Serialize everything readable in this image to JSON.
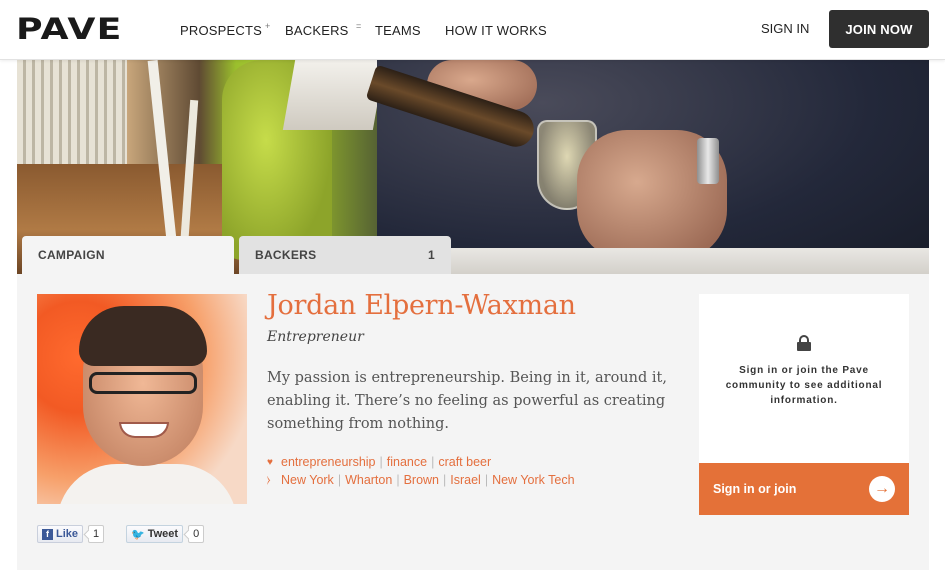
{
  "header": {
    "logo": "PAVE",
    "nav": [
      {
        "label": "PROSPECTS"
      },
      {
        "label": "BACKERS"
      },
      {
        "label": "TEAMS"
      },
      {
        "label": "HOW IT WORKS"
      }
    ],
    "nav_separators": [
      "+",
      "="
    ],
    "sign_in": "SIGN IN",
    "join_now": "JOIN NOW"
  },
  "tabs": [
    {
      "label": "CAMPAIGN",
      "count": "",
      "active": true
    },
    {
      "label": "BACKERS",
      "count": "1",
      "active": false
    }
  ],
  "profile": {
    "name": "Jordan Elpern-Waxman",
    "role": "Entrepreneur",
    "bio": "My passion is entrepreneurship. Being in it, around it, enabling it. There’s no feeling as powerful as creating something from nothing.",
    "interests": [
      "entrepreneurship",
      "finance",
      "craft beer"
    ],
    "affiliations": [
      "New York",
      "Wharton",
      "Brown",
      "Israel",
      "New York Tech"
    ]
  },
  "card": {
    "message": "Sign in or join the Pave community to see additional information.",
    "button": "Sign in or join",
    "arrow": "→"
  },
  "social": {
    "like_label": "Like",
    "like_count": "1",
    "tweet_label": "Tweet",
    "tweet_count": "0"
  },
  "colors": {
    "accent": "#e46f3e",
    "join_button_bg": "#2f2f2f",
    "panel_bg": "#f4f4f4"
  }
}
